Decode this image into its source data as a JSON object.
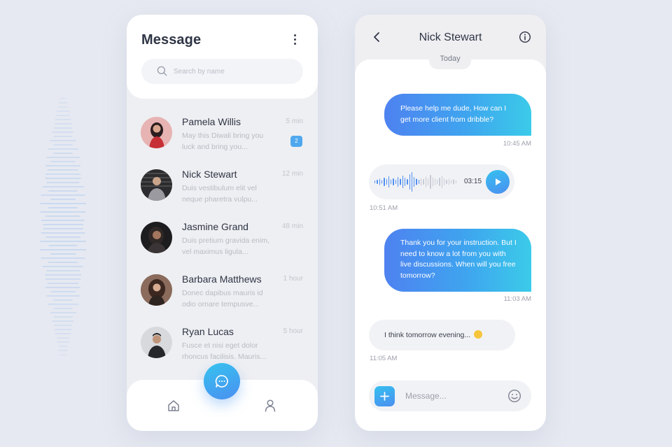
{
  "left_screen": {
    "title": "Message",
    "search": {
      "placeholder": "Search by name",
      "value": ""
    },
    "conversations": [
      {
        "name": "Pamela Willis",
        "time": "5 min",
        "preview": "May this Diwali bring you luck and bring you...",
        "unread": "2",
        "avatar": "avatar-pamela"
      },
      {
        "name": "Nick Stewart",
        "time": "12 min",
        "preview": "Duis vestibulum elit vel neque pharetra vulpu...",
        "avatar": "avatar-nick"
      },
      {
        "name": "Jasmine Grand",
        "time": "48 min",
        "preview": "Duis pretium gravida enim, vel maximus ligula...",
        "avatar": "avatar-jasmine"
      },
      {
        "name": "Barbara Matthews",
        "time": "1 hour",
        "preview": "Donec dapibus mauris id odio ornare tempusve...",
        "avatar": "avatar-barbara"
      },
      {
        "name": "Ryan Lucas",
        "time": "5 hour",
        "preview": "Fusce et nisi eget dolor rhoncus facilisis. Mauris...",
        "avatar": "avatar-ryan"
      }
    ],
    "icons": {
      "menu": "kebab-menu-icon",
      "search": "search-icon",
      "home": "home-icon",
      "profile": "user-icon",
      "compose": "chat-bubble-icon"
    }
  },
  "right_screen": {
    "contact_name": "Nick Stewart",
    "day_label": "Today",
    "messages": [
      {
        "direction": "out",
        "text": "Please help me dude, How can I get more client from dribble?",
        "time": "10:45 AM"
      },
      {
        "direction": "in",
        "type": "voice",
        "duration": "03:15",
        "time": "10:51 AM"
      },
      {
        "direction": "out",
        "text": "Thank you for your instruction. But I need to know a lot from you with live discussions. When will you free tomorrow?",
        "time": "11:03 AM"
      },
      {
        "direction": "in",
        "text": "I think tomorrow evening...",
        "time": "11:05 AM"
      }
    ],
    "composer": {
      "placeholder": "Message...",
      "value": ""
    },
    "icons": {
      "back": "chevron-left-icon",
      "info": "info-icon",
      "play": "play-icon",
      "add": "plus-icon",
      "emoji": "smiley-icon"
    }
  },
  "colors": {
    "accent_start": "#4e82f0",
    "accent_end": "#3bcbe9",
    "badge": "#4fa8ee",
    "background": "#e6e9f1",
    "text_dark": "#2f3545",
    "text_muted": "#b8bbc4"
  }
}
